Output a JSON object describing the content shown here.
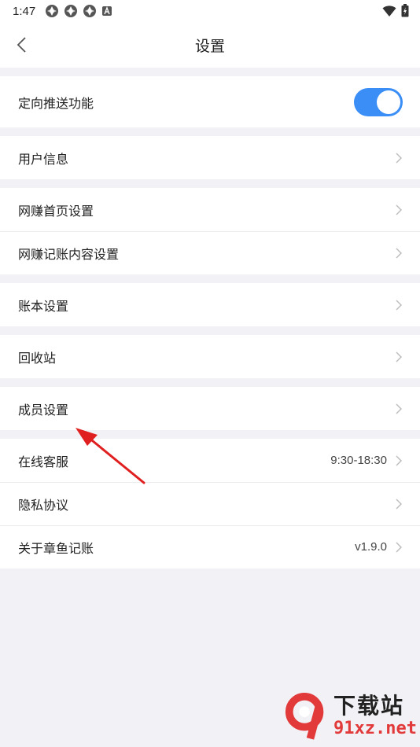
{
  "status_bar": {
    "time": "1:47",
    "notification_icons": [
      "app-notification-icon",
      "app-notification-icon",
      "app-notification-icon",
      "a-badge-icon"
    ],
    "right_icons": [
      "wifi-icon",
      "battery-icon"
    ]
  },
  "header": {
    "title": "设置",
    "back_icon": "chevron-left-icon"
  },
  "settings": {
    "push": {
      "label": "定向推送功能",
      "enabled": true
    },
    "user_info": {
      "label": "用户信息"
    },
    "home_settings": {
      "label": "网赚首页设置"
    },
    "content_settings": {
      "label": "网赚记账内容设置"
    },
    "account_book": {
      "label": "账本设置"
    },
    "recycle_bin": {
      "label": "回收站"
    },
    "members": {
      "label": "成员设置"
    },
    "online_service": {
      "label": "在线客服",
      "value": "9:30-18:30"
    },
    "privacy": {
      "label": "隐私协议"
    },
    "about": {
      "label": "关于章鱼记账",
      "value": "v1.9.0"
    }
  },
  "colors": {
    "accent": "#3a8ef6",
    "background": "#f2f2f6",
    "annotation_arrow": "#e02020"
  },
  "watermark": {
    "top": "下载站",
    "bottom": "91xz.net"
  }
}
